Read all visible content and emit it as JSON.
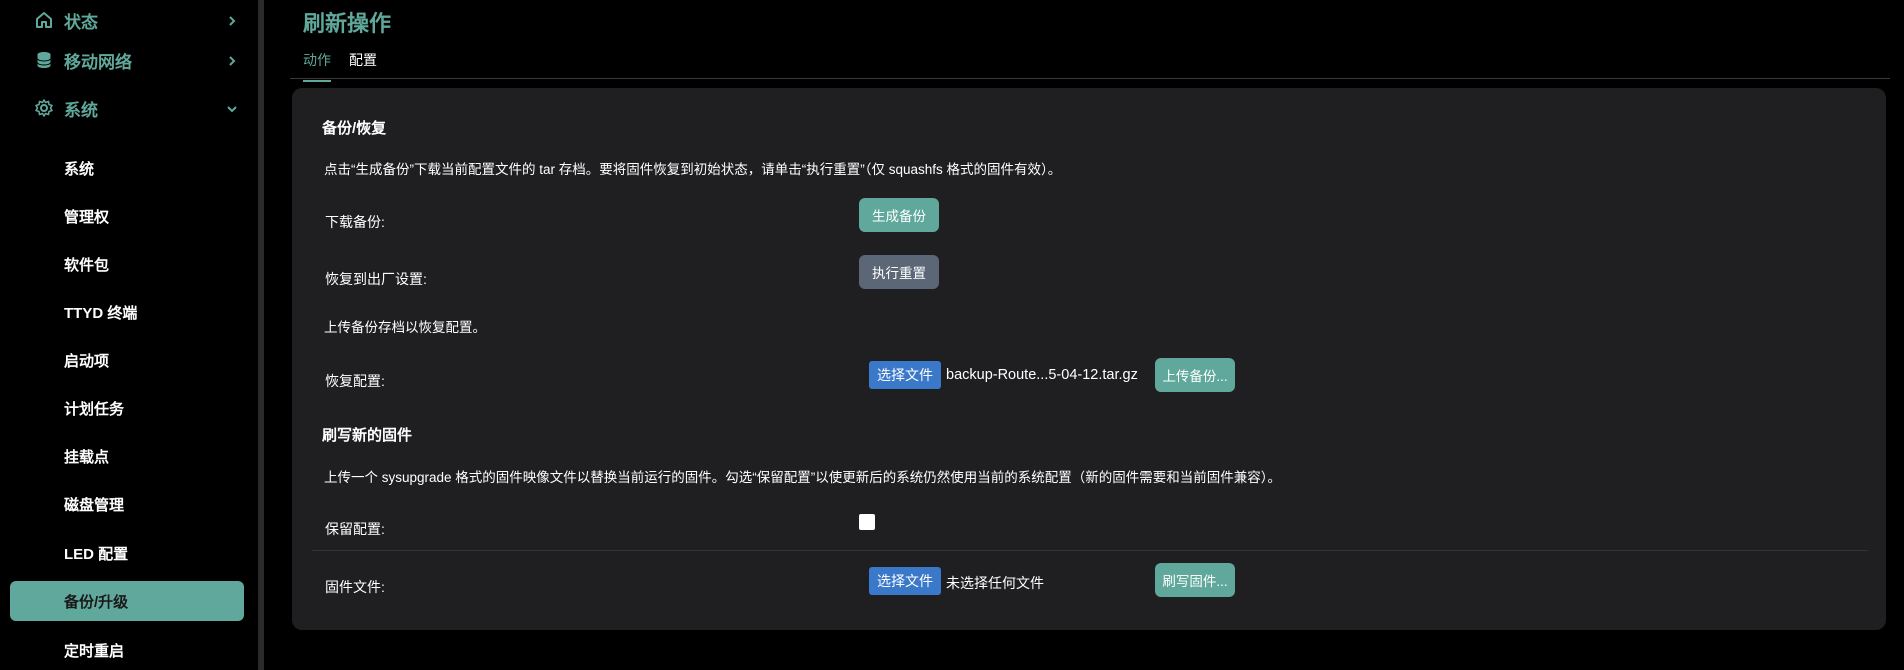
{
  "sidebar": {
    "top_items": [
      {
        "label": "状态",
        "icon": "home-icon",
        "expanded": false
      },
      {
        "label": "移动网络",
        "icon": "database-icon",
        "expanded": false
      },
      {
        "label": "系统",
        "icon": "gear-icon",
        "expanded": true
      }
    ],
    "sub_items": [
      {
        "label": "系统"
      },
      {
        "label": "管理权"
      },
      {
        "label": "软件包"
      },
      {
        "label": "TTYD 终端"
      },
      {
        "label": "启动项"
      },
      {
        "label": "计划任务"
      },
      {
        "label": "挂载点"
      },
      {
        "label": "磁盘管理"
      },
      {
        "label": "LED 配置"
      },
      {
        "label": "备份/升级",
        "active": true
      },
      {
        "label": "定时重启"
      }
    ]
  },
  "page": {
    "title": "刷新操作",
    "tabs": [
      {
        "label": "动作",
        "active": true
      },
      {
        "label": "配置",
        "active": false
      }
    ]
  },
  "backup": {
    "title": "备份/恢复",
    "description": "点击“生成备份”下载当前配置文件的 tar 存档。要将固件恢复到初始状态，请单击“执行重置”（仅 squashfs 格式的固件有效）。",
    "download_label": "下载备份:",
    "generate_button": "生成备份",
    "reset_label": "恢复到出厂设置:",
    "reset_button": "执行重置",
    "upload_hint": "上传备份存档以恢复配置。",
    "restore_label": "恢复配置:",
    "choose_file": "选择文件",
    "chosen_file": "backup-Route...5-04-12.tar.gz",
    "upload_button": "上传备份..."
  },
  "firmware": {
    "title": "刷写新的固件",
    "description": "上传一个 sysupgrade 格式的固件映像文件以替换当前运行的固件。勾选“保留配置”以使更新后的系统仍然使用当前的系统配置（新的固件需要和当前固件兼容）。",
    "keep_label": "保留配置:",
    "keep_checked": false,
    "file_label": "固件文件:",
    "choose_file": "选择文件",
    "no_file": "未选择任何文件",
    "flash_button": "刷写固件..."
  },
  "colors": {
    "accent": "#5fa89b",
    "card_bg": "#1f1f22",
    "reset_button": "#5b6676",
    "file_button": "#3a78c9"
  }
}
